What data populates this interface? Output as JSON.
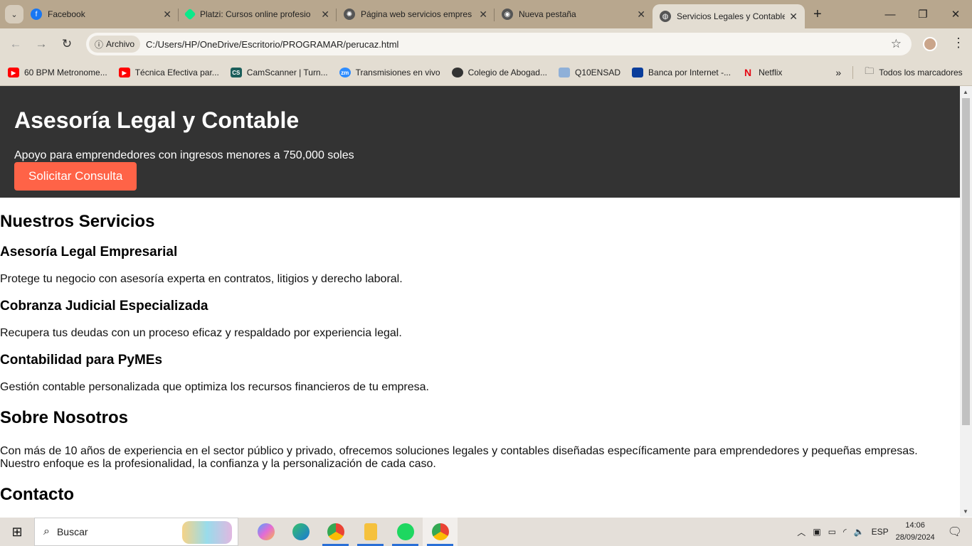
{
  "browser": {
    "tabs": [
      {
        "title": "Facebook",
        "icon": "facebook-icon",
        "color": "#1877f2"
      },
      {
        "title": "Platzi: Cursos online profesio",
        "icon": "platzi-icon",
        "color": "#0ae98a"
      },
      {
        "title": "Página web servicios empres",
        "icon": "chatgpt-icon",
        "color": "#555555"
      },
      {
        "title": "Nueva pestaña",
        "icon": "chrome-icon",
        "color": "#555555"
      },
      {
        "title": "Servicios Legales y Contable",
        "icon": "globe-icon",
        "color": "#555555",
        "active": true
      }
    ],
    "address": {
      "chip": "Archivo",
      "url": "C:/Users/HP/OneDrive/Escritorio/PROGRAMAR/perucaz.html"
    },
    "bookmarks": [
      {
        "label": "60 BPM Metronome...",
        "icon": "youtube-icon",
        "color": "#ff0000"
      },
      {
        "label": "Técnica Efectiva par...",
        "icon": "youtube-icon",
        "color": "#ff0000"
      },
      {
        "label": "CamScanner | Turn...",
        "icon": "camscanner-icon",
        "color": "#1b5e5a"
      },
      {
        "label": "Transmisiones en vivo",
        "icon": "zoom-icon",
        "color": "#2d8cff"
      },
      {
        "label": "Colegio de Abogad...",
        "icon": "globe-icon",
        "color": "#333333"
      },
      {
        "label": "Q10ENSAD",
        "icon": "document-icon",
        "color": "#8fb0d8"
      },
      {
        "label": "Banca por Internet -...",
        "icon": "bank-icon",
        "color": "#0a3d9b"
      },
      {
        "label": "Netflix",
        "icon": "netflix-icon",
        "color": "#e50914"
      }
    ],
    "all_bookmarks": "Todos los marcadores"
  },
  "page": {
    "header": {
      "title": "Asesoría Legal y Contable",
      "subtitle": "Apoyo para emprendedores con ingresos menores a 750,000 soles",
      "cta": "Solicitar Consulta"
    },
    "services_title": "Nuestros Servicios",
    "services": [
      {
        "title": "Asesoría Legal Empresarial",
        "desc": "Protege tu negocio con asesoría experta en contratos, litigios y derecho laboral."
      },
      {
        "title": "Cobranza Judicial Especializada",
        "desc": "Recupera tus deudas con un proceso eficaz y respaldado por experiencia legal."
      },
      {
        "title": "Contabilidad para PyMEs",
        "desc": "Gestión contable personalizada que optimiza los recursos financieros de tu empresa."
      }
    ],
    "about_title": "Sobre Nosotros",
    "about_text": "Con más de 10 años de experiencia en el sector público y privado, ofrecemos soluciones legales y contables diseñadas específicamente para emprendedores y pequeñas empresas. Nuestro enfoque es la profesionalidad, la confianza y la personalización de cada caso.",
    "contact_title": "Contacto",
    "accent": "#ff6347"
  },
  "taskbar": {
    "search": "Buscar",
    "lang": "ESP",
    "time": "14:06",
    "date": "28/09/2024"
  }
}
